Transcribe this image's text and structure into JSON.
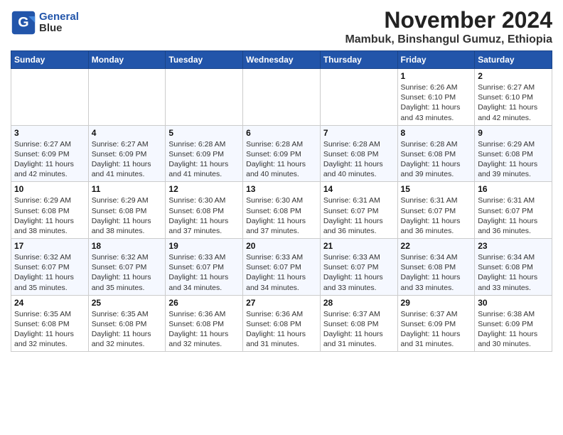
{
  "header": {
    "logo_line1": "General",
    "logo_line2": "Blue",
    "month": "November 2024",
    "location": "Mambuk, Binshangul Gumuz, Ethiopia"
  },
  "weekdays": [
    "Sunday",
    "Monday",
    "Tuesday",
    "Wednesday",
    "Thursday",
    "Friday",
    "Saturday"
  ],
  "weeks": [
    [
      {
        "day": "",
        "info": ""
      },
      {
        "day": "",
        "info": ""
      },
      {
        "day": "",
        "info": ""
      },
      {
        "day": "",
        "info": ""
      },
      {
        "day": "",
        "info": ""
      },
      {
        "day": "1",
        "info": "Sunrise: 6:26 AM\nSunset: 6:10 PM\nDaylight: 11 hours\nand 43 minutes."
      },
      {
        "day": "2",
        "info": "Sunrise: 6:27 AM\nSunset: 6:10 PM\nDaylight: 11 hours\nand 42 minutes."
      }
    ],
    [
      {
        "day": "3",
        "info": "Sunrise: 6:27 AM\nSunset: 6:09 PM\nDaylight: 11 hours\nand 42 minutes."
      },
      {
        "day": "4",
        "info": "Sunrise: 6:27 AM\nSunset: 6:09 PM\nDaylight: 11 hours\nand 41 minutes."
      },
      {
        "day": "5",
        "info": "Sunrise: 6:28 AM\nSunset: 6:09 PM\nDaylight: 11 hours\nand 41 minutes."
      },
      {
        "day": "6",
        "info": "Sunrise: 6:28 AM\nSunset: 6:09 PM\nDaylight: 11 hours\nand 40 minutes."
      },
      {
        "day": "7",
        "info": "Sunrise: 6:28 AM\nSunset: 6:08 PM\nDaylight: 11 hours\nand 40 minutes."
      },
      {
        "day": "8",
        "info": "Sunrise: 6:28 AM\nSunset: 6:08 PM\nDaylight: 11 hours\nand 39 minutes."
      },
      {
        "day": "9",
        "info": "Sunrise: 6:29 AM\nSunset: 6:08 PM\nDaylight: 11 hours\nand 39 minutes."
      }
    ],
    [
      {
        "day": "10",
        "info": "Sunrise: 6:29 AM\nSunset: 6:08 PM\nDaylight: 11 hours\nand 38 minutes."
      },
      {
        "day": "11",
        "info": "Sunrise: 6:29 AM\nSunset: 6:08 PM\nDaylight: 11 hours\nand 38 minutes."
      },
      {
        "day": "12",
        "info": "Sunrise: 6:30 AM\nSunset: 6:08 PM\nDaylight: 11 hours\nand 37 minutes."
      },
      {
        "day": "13",
        "info": "Sunrise: 6:30 AM\nSunset: 6:08 PM\nDaylight: 11 hours\nand 37 minutes."
      },
      {
        "day": "14",
        "info": "Sunrise: 6:31 AM\nSunset: 6:07 PM\nDaylight: 11 hours\nand 36 minutes."
      },
      {
        "day": "15",
        "info": "Sunrise: 6:31 AM\nSunset: 6:07 PM\nDaylight: 11 hours\nand 36 minutes."
      },
      {
        "day": "16",
        "info": "Sunrise: 6:31 AM\nSunset: 6:07 PM\nDaylight: 11 hours\nand 36 minutes."
      }
    ],
    [
      {
        "day": "17",
        "info": "Sunrise: 6:32 AM\nSunset: 6:07 PM\nDaylight: 11 hours\nand 35 minutes."
      },
      {
        "day": "18",
        "info": "Sunrise: 6:32 AM\nSunset: 6:07 PM\nDaylight: 11 hours\nand 35 minutes."
      },
      {
        "day": "19",
        "info": "Sunrise: 6:33 AM\nSunset: 6:07 PM\nDaylight: 11 hours\nand 34 minutes."
      },
      {
        "day": "20",
        "info": "Sunrise: 6:33 AM\nSunset: 6:07 PM\nDaylight: 11 hours\nand 34 minutes."
      },
      {
        "day": "21",
        "info": "Sunrise: 6:33 AM\nSunset: 6:07 PM\nDaylight: 11 hours\nand 33 minutes."
      },
      {
        "day": "22",
        "info": "Sunrise: 6:34 AM\nSunset: 6:08 PM\nDaylight: 11 hours\nand 33 minutes."
      },
      {
        "day": "23",
        "info": "Sunrise: 6:34 AM\nSunset: 6:08 PM\nDaylight: 11 hours\nand 33 minutes."
      }
    ],
    [
      {
        "day": "24",
        "info": "Sunrise: 6:35 AM\nSunset: 6:08 PM\nDaylight: 11 hours\nand 32 minutes."
      },
      {
        "day": "25",
        "info": "Sunrise: 6:35 AM\nSunset: 6:08 PM\nDaylight: 11 hours\nand 32 minutes."
      },
      {
        "day": "26",
        "info": "Sunrise: 6:36 AM\nSunset: 6:08 PM\nDaylight: 11 hours\nand 32 minutes."
      },
      {
        "day": "27",
        "info": "Sunrise: 6:36 AM\nSunset: 6:08 PM\nDaylight: 11 hours\nand 31 minutes."
      },
      {
        "day": "28",
        "info": "Sunrise: 6:37 AM\nSunset: 6:08 PM\nDaylight: 11 hours\nand 31 minutes."
      },
      {
        "day": "29",
        "info": "Sunrise: 6:37 AM\nSunset: 6:09 PM\nDaylight: 11 hours\nand 31 minutes."
      },
      {
        "day": "30",
        "info": "Sunrise: 6:38 AM\nSunset: 6:09 PM\nDaylight: 11 hours\nand 30 minutes."
      }
    ]
  ]
}
